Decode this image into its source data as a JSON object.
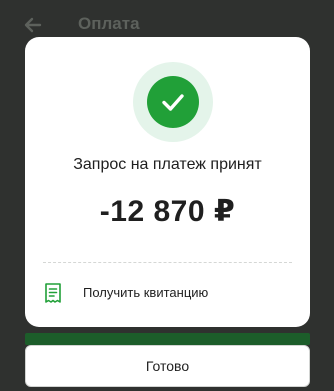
{
  "header": {
    "title": "Оплата",
    "back_icon": "arrow-left-icon"
  },
  "modal": {
    "status_icon": "check-circle-icon",
    "status_text": "Запрос на платеж принят",
    "amount": "-12 870 ₽",
    "receipt_icon": "receipt-icon",
    "receipt_label": "Получить квитанцию"
  },
  "footer": {
    "done_label": "Готово"
  },
  "colors": {
    "accent_green": "#21a038",
    "green_ring": "#e4f4ea",
    "dark_background": "#2f312f"
  }
}
